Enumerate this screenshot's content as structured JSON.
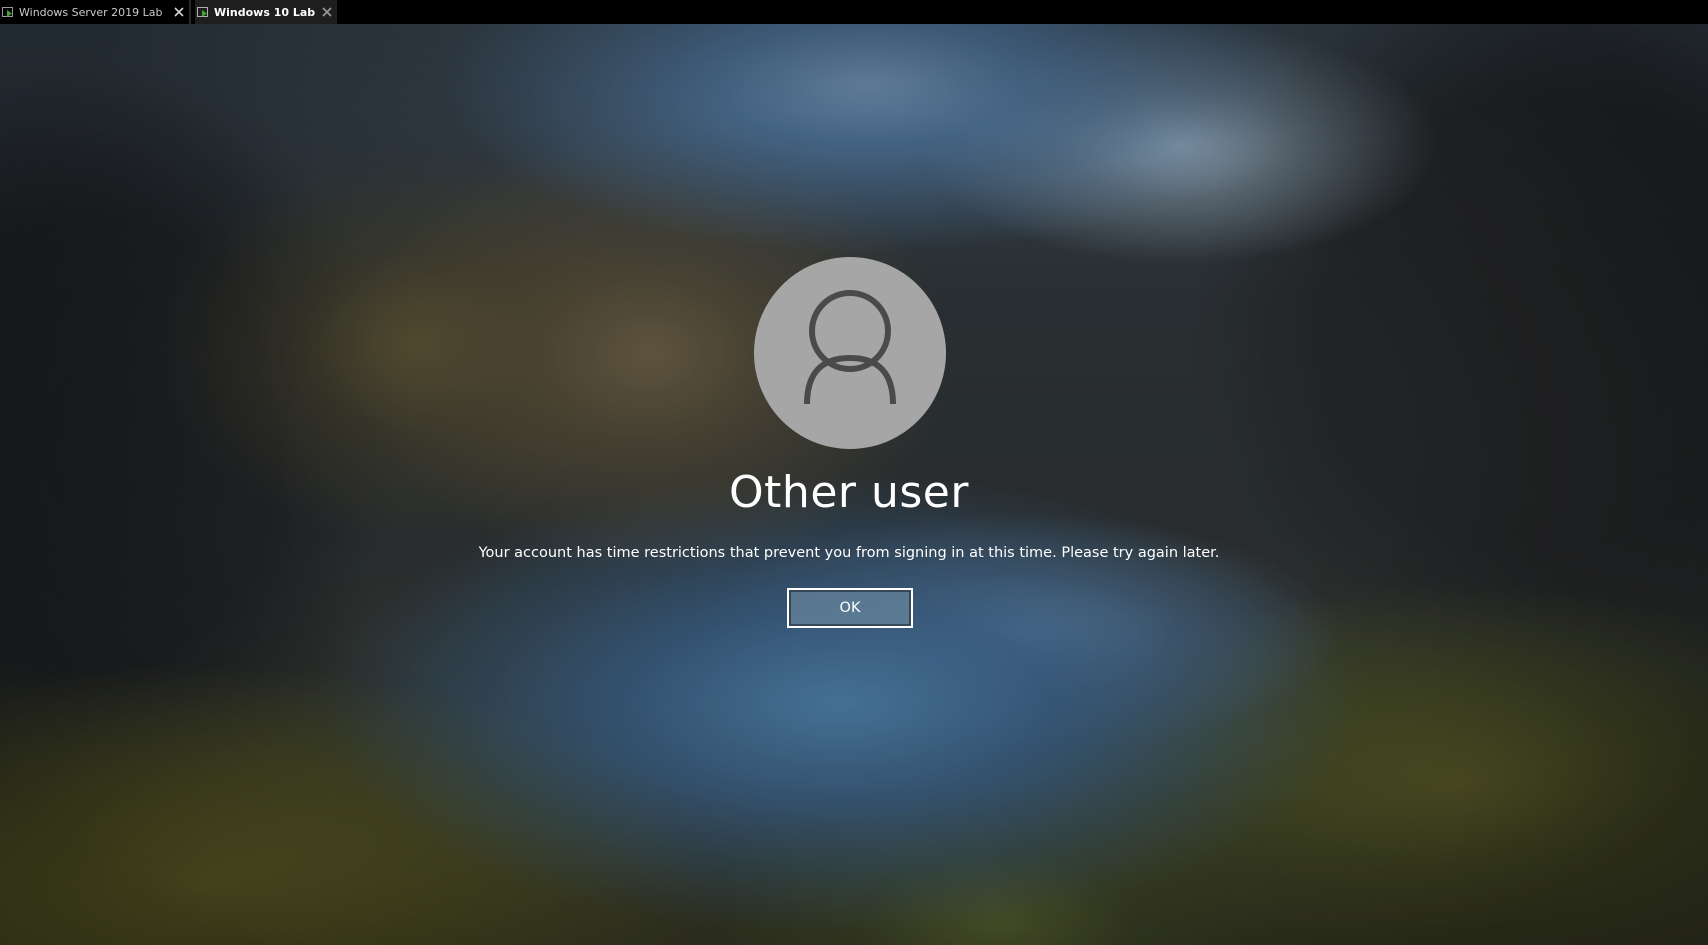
{
  "tabs": [
    {
      "label": "Windows Server 2019 Lab",
      "active": false
    },
    {
      "label": "Windows 10 Lab",
      "active": true
    }
  ],
  "login": {
    "user_name": "Other user",
    "message": "Your account has time restrictions that prevent you from signing in at this time. Please try again later.",
    "ok_label": "OK"
  },
  "icons": {
    "vm": "vm-icon",
    "close": "close-icon",
    "avatar": "user-avatar-icon"
  },
  "colors": {
    "avatar_bg": "#a6a6a6",
    "avatar_glyph": "#4a4a4a",
    "tab_icon_accent": "#3fa52f"
  }
}
